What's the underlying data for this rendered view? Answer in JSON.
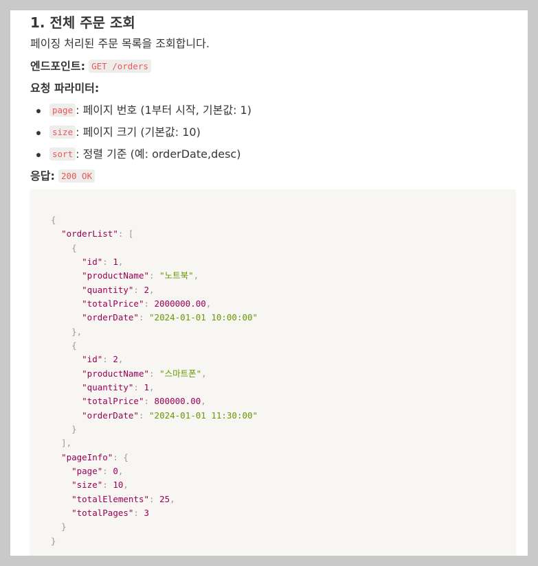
{
  "section": {
    "title": "1. 전체 주문 조회",
    "description": "페이징 처리된 주문 목록을 조회합니다.",
    "endpoint_label": "엔드포인트:",
    "endpoint": "GET /orders",
    "params_label": "요청 파라미터:",
    "params": [
      {
        "name": "page",
        "desc": ": 페이지 번호 (1부터 시작, 기본값: 1)"
      },
      {
        "name": "size",
        "desc": ": 페이지 크기 (기본값: 10)"
      },
      {
        "name": "sort",
        "desc": ": 정렬 기준 (예: orderDate,desc)"
      }
    ],
    "response_label": "응답:",
    "response_status": "200 OK"
  },
  "response_body": {
    "orderList": [
      {
        "id": 1,
        "productName": "노트북",
        "quantity": 2,
        "totalPrice": "2000000.00",
        "orderDate": "2024-01-01 10:00:00"
      },
      {
        "id": 2,
        "productName": "스마트폰",
        "quantity": 1,
        "totalPrice": "800000.00",
        "orderDate": "2024-01-01 11:30:00"
      }
    ],
    "pageInfo": {
      "page": 0,
      "size": 10,
      "totalElements": 25,
      "totalPages": 3
    }
  },
  "colors": {
    "inline_code": "#eb5757",
    "code_key": "#990055",
    "code_string": "#669900",
    "code_punct": "#999999",
    "code_bg": "#f7f6f3"
  }
}
